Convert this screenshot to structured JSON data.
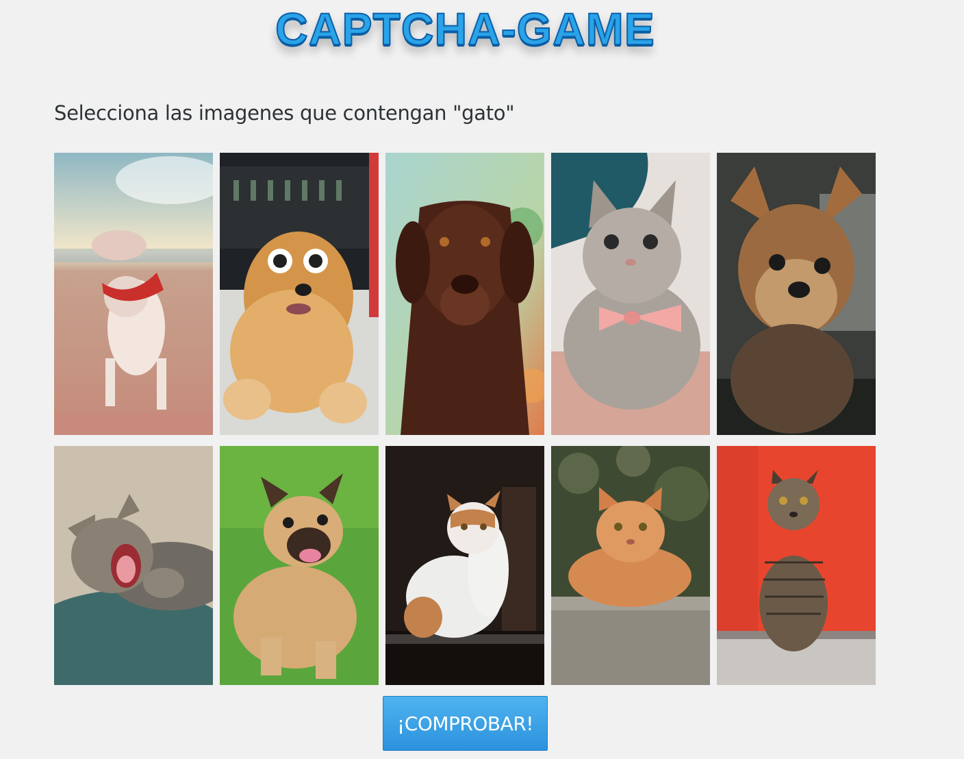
{
  "header": {
    "title": "CAPTCHA-GAME"
  },
  "instructions": {
    "prompt": "Selecciona las imagenes que contengan \"gato\""
  },
  "images": [
    {
      "animal": "dog",
      "description": "pit bull puppy with red bandana on a beach"
    },
    {
      "animal": "dog",
      "description": "fluffy chow chow with white sunglasses"
    },
    {
      "animal": "dog",
      "description": "chocolate labrador portrait"
    },
    {
      "animal": "cat",
      "description": "tabby cat wearing a pink bow tie"
    },
    {
      "animal": "dog",
      "description": "yorkshire terrier portrait"
    },
    {
      "animal": "cat",
      "description": "yawning tabby cat on a teal blanket"
    },
    {
      "animal": "dog",
      "description": "french bulldog on green grass"
    },
    {
      "animal": "cat",
      "description": "white and orange cat on a glass table"
    },
    {
      "animal": "cat",
      "description": "orange cat lying on a stone wall"
    },
    {
      "animal": "cat",
      "description": "tabby cat sitting in front of a red wall"
    }
  ],
  "actions": {
    "check_label": "¡COMPROBAR!"
  },
  "colors": {
    "background": "#f1f1f1",
    "title_fill": "#2aa3e8",
    "button_fill": "#3aa2e6",
    "button_text": "#ffffff"
  }
}
